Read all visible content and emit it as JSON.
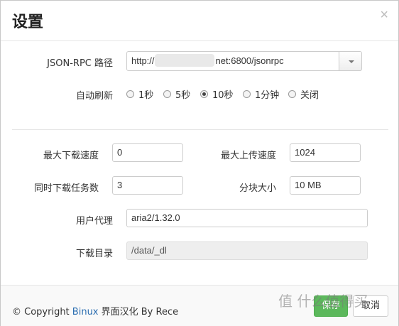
{
  "dialog": {
    "title": "设置",
    "close_glyph": "×"
  },
  "rpc": {
    "label": "JSON-RPC 路径",
    "value_prefix": "http://",
    "value_suffix": "net:6800/jsonrpc"
  },
  "refresh": {
    "label": "自动刷新",
    "options": [
      "1秒",
      "5秒",
      "10秒",
      "1分钟",
      "关闭"
    ],
    "selected": "10秒"
  },
  "fields": {
    "max_download": {
      "label": "最大下载速度",
      "value": "0"
    },
    "max_upload": {
      "label": "最大上传速度",
      "value": "1024"
    },
    "concurrent": {
      "label": "同时下载任务数",
      "value": "3"
    },
    "chunk_size": {
      "label": "分块大小",
      "value": "10 MB"
    },
    "user_agent": {
      "label": "用户代理",
      "value": "aria2/1.32.0"
    },
    "download_dir": {
      "label": "下载目录",
      "value": "/data/_dl"
    }
  },
  "footer": {
    "copyright_prefix": "© Copyright ",
    "link": "Binux",
    "copyright_suffix": " 界面汉化 By Rece",
    "save_label": "保存",
    "cancel_label": "取消"
  },
  "watermark": "值 什么值得买",
  "icons": {
    "close": "close-icon",
    "dropdown": "chevron-down-icon"
  }
}
